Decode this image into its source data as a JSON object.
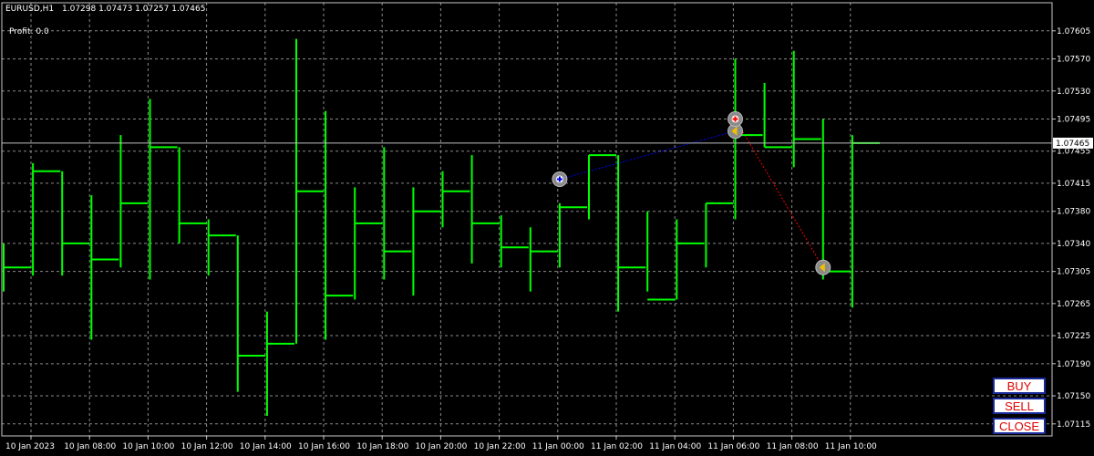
{
  "chart_header": {
    "symbol": "EURUSD,H1",
    "ohlc": "1.07298 1.07473 1.07257 1.07465",
    "profit_label": "Profit: 0.0"
  },
  "trade_buttons": {
    "buy": "BUY",
    "sell": "SELL",
    "close": "CLOSE"
  },
  "colors": {
    "background": "#000000",
    "bars": "#00ff00",
    "grid": "#8a8a8a",
    "bid_line": "#c0c0c0",
    "button_text": "#e00000",
    "button_border": "#1a2a9a",
    "buy_trade_line": "#0000ff",
    "sell_trade_line": "#ff0000"
  },
  "icons": {
    "buy_marker": "blue-plus-circle-icon",
    "sell_marker": "red-plus-circle-icon",
    "close_marker": "arrow-circle-icon"
  },
  "chart_data": {
    "type": "ohlc",
    "timeframe": "H1",
    "ylim": [
      1.071,
      1.0764
    ],
    "grid": true,
    "price_ticks": [
      "1.07605",
      "1.07570",
      "1.07530",
      "1.07495",
      "1.07455",
      "1.07415",
      "1.07380",
      "1.07340",
      "1.07305",
      "1.07265",
      "1.07225",
      "1.07190",
      "1.07150",
      "1.07115"
    ],
    "time_ticks": [
      "10 Jan 2023",
      "10 Jan 08:00",
      "10 Jan 10:00",
      "10 Jan 12:00",
      "10 Jan 14:00",
      "10 Jan 16:00",
      "10 Jan 18:00",
      "10 Jan 20:00",
      "10 Jan 22:00",
      "11 Jan 00:00",
      "11 Jan 02:00",
      "11 Jan 04:00",
      "11 Jan 06:00",
      "11 Jan 08:00",
      "11 Jan 10:00"
    ],
    "current_price": "1.07465",
    "bars": [
      [
        1.0731,
        1.0734,
        1.0728,
        1.0731
      ],
      [
        1.07305,
        1.0744,
        1.073,
        1.0743
      ],
      [
        1.0743,
        1.0743,
        1.073,
        1.0734
      ],
      [
        1.0734,
        1.074,
        1.0722,
        1.0732
      ],
      [
        1.0732,
        1.07475,
        1.0731,
        1.0739
      ],
      [
        1.0739,
        1.0752,
        1.07295,
        1.0746
      ],
      [
        1.0746,
        1.0746,
        1.0734,
        1.07365
      ],
      [
        1.07365,
        1.0737,
        1.073,
        1.0735
      ],
      [
        1.0735,
        1.0735,
        1.07155,
        1.072
      ],
      [
        1.072,
        1.07255,
        1.07125,
        1.07215
      ],
      [
        1.07215,
        1.07595,
        1.07215,
        1.07405
      ],
      [
        1.07405,
        1.07505,
        1.0722,
        1.07275
      ],
      [
        1.07275,
        1.0741,
        1.0727,
        1.07365
      ],
      [
        1.07365,
        1.0746,
        1.07295,
        1.0733
      ],
      [
        1.0733,
        1.0741,
        1.07275,
        1.0738
      ],
      [
        1.0738,
        1.0743,
        1.0736,
        1.07405
      ],
      [
        1.07405,
        1.0745,
        1.07315,
        1.07365
      ],
      [
        1.07365,
        1.07375,
        1.0731,
        1.07335
      ],
      [
        1.07335,
        1.0736,
        1.0728,
        1.0733
      ],
      [
        1.0733,
        1.0739,
        1.0731,
        1.07385
      ],
      [
        1.07385,
        1.0745,
        1.0737,
        1.0745
      ],
      [
        1.0745,
        1.0745,
        1.07255,
        1.0731
      ],
      [
        1.0731,
        1.0738,
        1.0728,
        1.0727
      ],
      [
        1.0727,
        1.0737,
        1.0727,
        1.0734
      ],
      [
        1.0734,
        1.0739,
        1.0731,
        1.0739
      ],
      [
        1.0739,
        1.0757,
        1.0737,
        1.07475
      ],
      [
        1.07475,
        1.0754,
        1.0746,
        1.0746
      ],
      [
        1.0746,
        1.0758,
        1.07435,
        1.0747
      ],
      [
        1.0747,
        1.07495,
        1.07295,
        1.07305
      ],
      [
        1.07305,
        1.07475,
        1.0726,
        1.07465
      ]
    ],
    "trades": [
      {
        "type": "buy",
        "open_bar": 19,
        "open_price": 1.0742,
        "close_bar": 25,
        "close_price": 1.0748
      },
      {
        "type": "sell",
        "open_bar": 25,
        "open_price": 1.07495,
        "close_bar": 28,
        "close_price": 1.0731
      }
    ]
  }
}
